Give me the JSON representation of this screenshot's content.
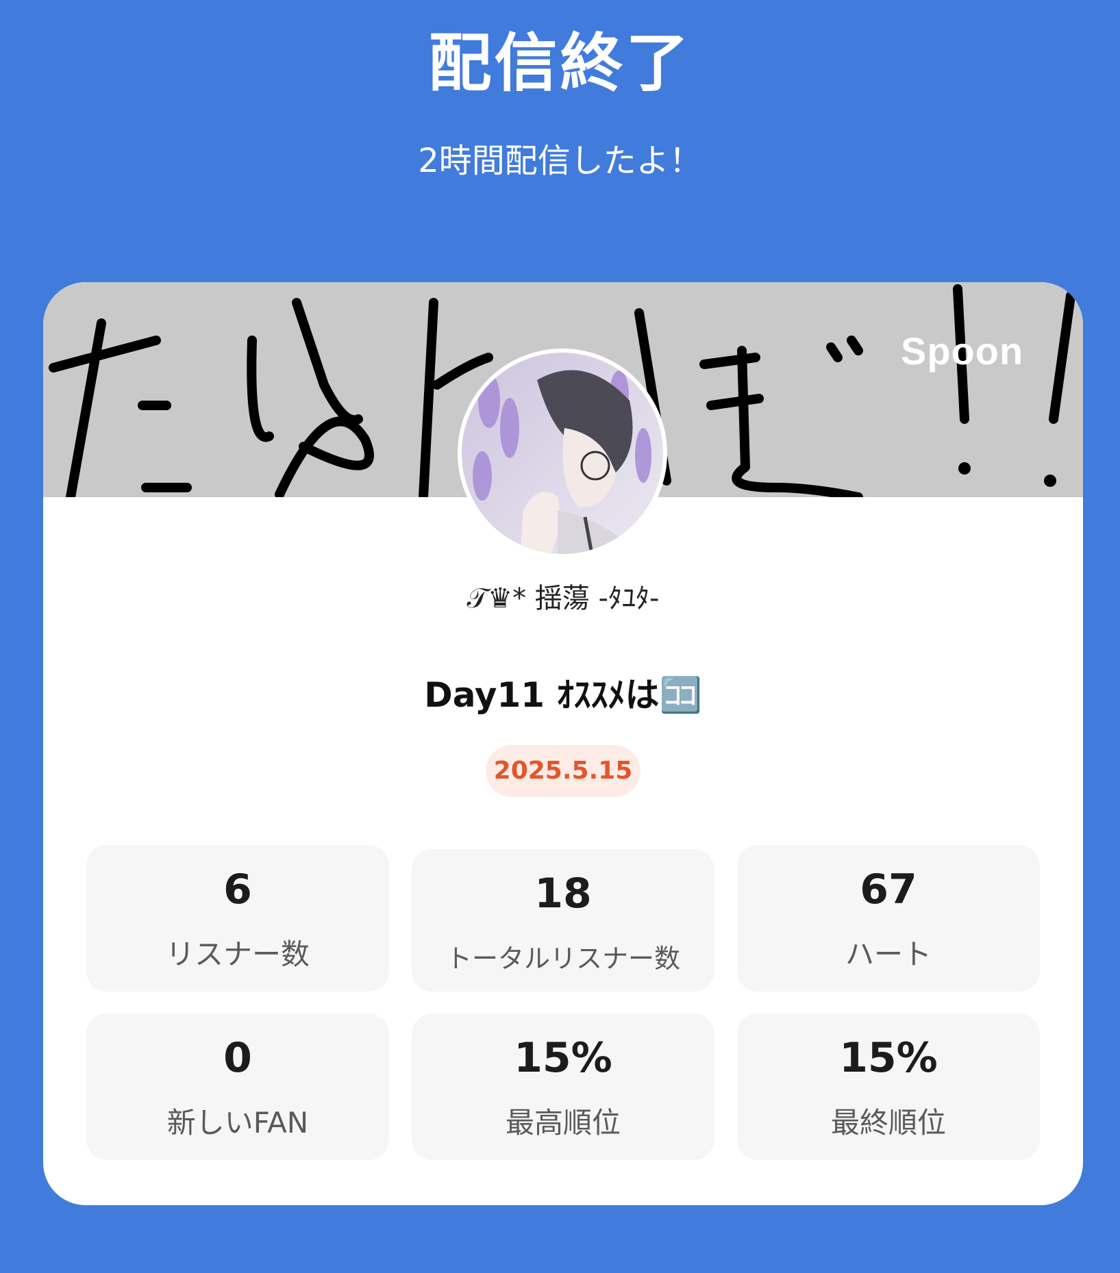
{
  "header": {
    "title": "配信終了",
    "subtitle": "2時間配信したよ！"
  },
  "banner": {
    "logo_text": "Spoon",
    "handwriting_text": "たゆとーほ゛!!"
  },
  "profile": {
    "avatar": "anime-avatar-image",
    "username": "𝒯♛* 揺蕩 -ﾀﾕﾀ-"
  },
  "stream": {
    "title": "Day11 ｵｽｽﾒは🈁",
    "date": "2025.5.15"
  },
  "stats": [
    {
      "value": "6",
      "label": "リスナー数"
    },
    {
      "value": "18",
      "label": "トータルリスナー数"
    },
    {
      "value": "67",
      "label": "ハート"
    },
    {
      "value": "0",
      "label": "新しいFAN"
    },
    {
      "value": "15%",
      "label": "最高順位"
    },
    {
      "value": "15%",
      "label": "最終順位"
    }
  ],
  "colors": {
    "background": "#417bdb",
    "card": "#ffffff",
    "banner": "#c9c9c9",
    "date_text": "#e4552a",
    "date_badge": "#fdece6",
    "tile": "#f6f6f6"
  }
}
